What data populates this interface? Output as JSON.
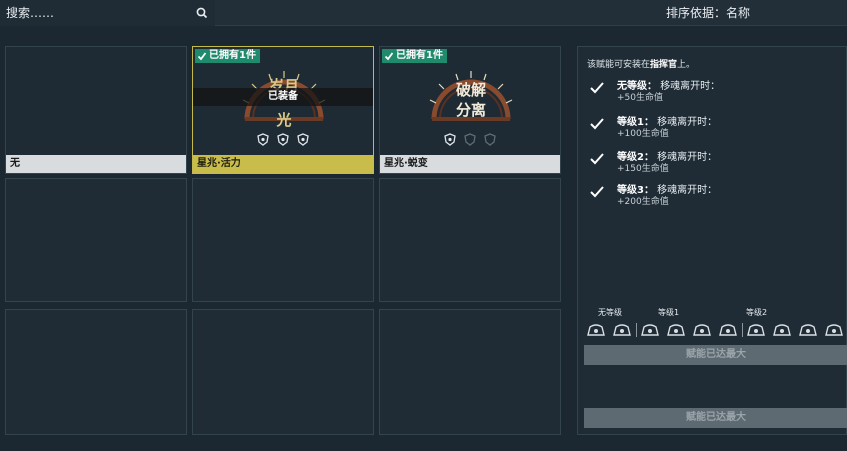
{
  "search": {
    "placeholder": "搜索……"
  },
  "sort": {
    "label": "排序依据：名称"
  },
  "grid": {
    "cells": [
      {
        "name": "无"
      },
      {
        "name": "星兆·活力",
        "owned": "已拥有1件",
        "equipped": "已装备",
        "icon_text": "岁月 光",
        "selected": true
      },
      {
        "name": "星兆·蜕变",
        "owned": "已拥有1件",
        "icon_text": "破解 分离"
      }
    ]
  },
  "panel": {
    "intro_prefix": "该赋能可安装在",
    "intro_bold": "指挥官",
    "intro_suffix": "上。",
    "tiers": [
      {
        "level": "无等级：",
        "desc": "移魂离开时：",
        "bonus": "+50生命值"
      },
      {
        "level": "等级1：",
        "desc": "移魂离开时：",
        "bonus": "+100生命值"
      },
      {
        "level": "等级2：",
        "desc": "移魂离开时：",
        "bonus": "+150生命值"
      },
      {
        "level": "等级3：",
        "desc": "移魂离开时：",
        "bonus": "+200生命值"
      }
    ],
    "level_labels": [
      "无等级",
      "等级1",
      "等级2"
    ],
    "max_button_1": "赋能已达最大",
    "max_button_2": "赋能已达最大"
  },
  "colors": {
    "background": "#1b2832",
    "owned_badge": "#1f8b6c",
    "selected_footer": "#c8bd4a",
    "emblem_gold": "#d9c98a",
    "emblem_copper": "#8a4a2e"
  }
}
